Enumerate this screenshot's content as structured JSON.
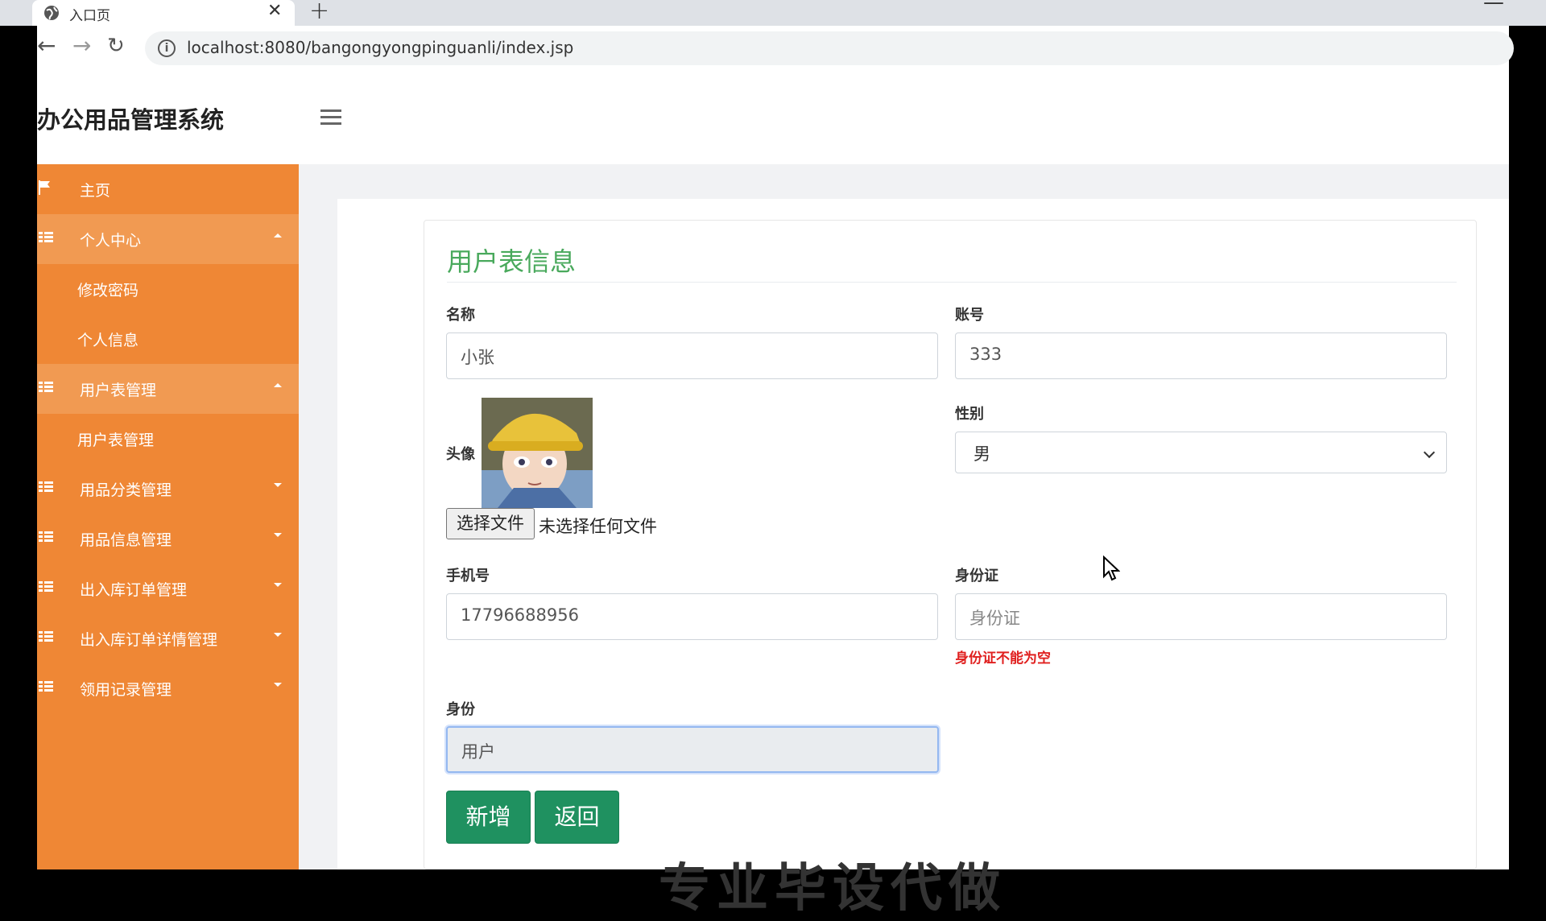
{
  "browser": {
    "tab_title": "入口页",
    "close_glyph": "✕",
    "new_tab_glyph": "+",
    "minimize_glyph": "—",
    "back_glyph": "←",
    "forward_glyph": "→",
    "reload_glyph": "↻",
    "url": "localhost:8080/bangongyongpinguanli/index.jsp"
  },
  "header": {
    "brand": "办公用品管理系统"
  },
  "sidebar": {
    "items": [
      {
        "label": "主页",
        "icon": "flag-icon"
      },
      {
        "label": "个人中心",
        "icon": "grid-icon",
        "expanded": true
      },
      {
        "label": "修改密码"
      },
      {
        "label": "个人信息"
      },
      {
        "label": "用户表管理",
        "icon": "grid-icon",
        "expanded": true
      },
      {
        "label": "用户表管理"
      },
      {
        "label": "用品分类管理",
        "icon": "grid-icon"
      },
      {
        "label": "用品信息管理",
        "icon": "grid-icon"
      },
      {
        "label": "出入库订单管理",
        "icon": "grid-icon"
      },
      {
        "label": "出入库订单详情管理",
        "icon": "grid-icon"
      },
      {
        "label": "领用记录管理",
        "icon": "grid-icon"
      }
    ]
  },
  "form": {
    "title": "用户表信息",
    "name_label": "名称",
    "name_value": "小张",
    "account_label": "账号",
    "account_value": "333",
    "avatar_label": "头像",
    "file_button": "选择文件",
    "file_status": "未选择任何文件",
    "gender_label": "性别",
    "gender_value": "男",
    "phone_label": "手机号",
    "phone_value": "17796688956",
    "id_label": "身份证",
    "id_placeholder": "身份证",
    "id_error": "身份证不能为空",
    "role_label": "身份",
    "role_value": "用户",
    "add_button": "新增",
    "back_button": "返回"
  },
  "colors": {
    "sidebar": "#ef8735",
    "sidebar_active": "#f19a52",
    "title_green": "#49a95c",
    "button_green": "#1f9160",
    "error_red": "#e0201f"
  },
  "watermark": "专业毕设代做"
}
